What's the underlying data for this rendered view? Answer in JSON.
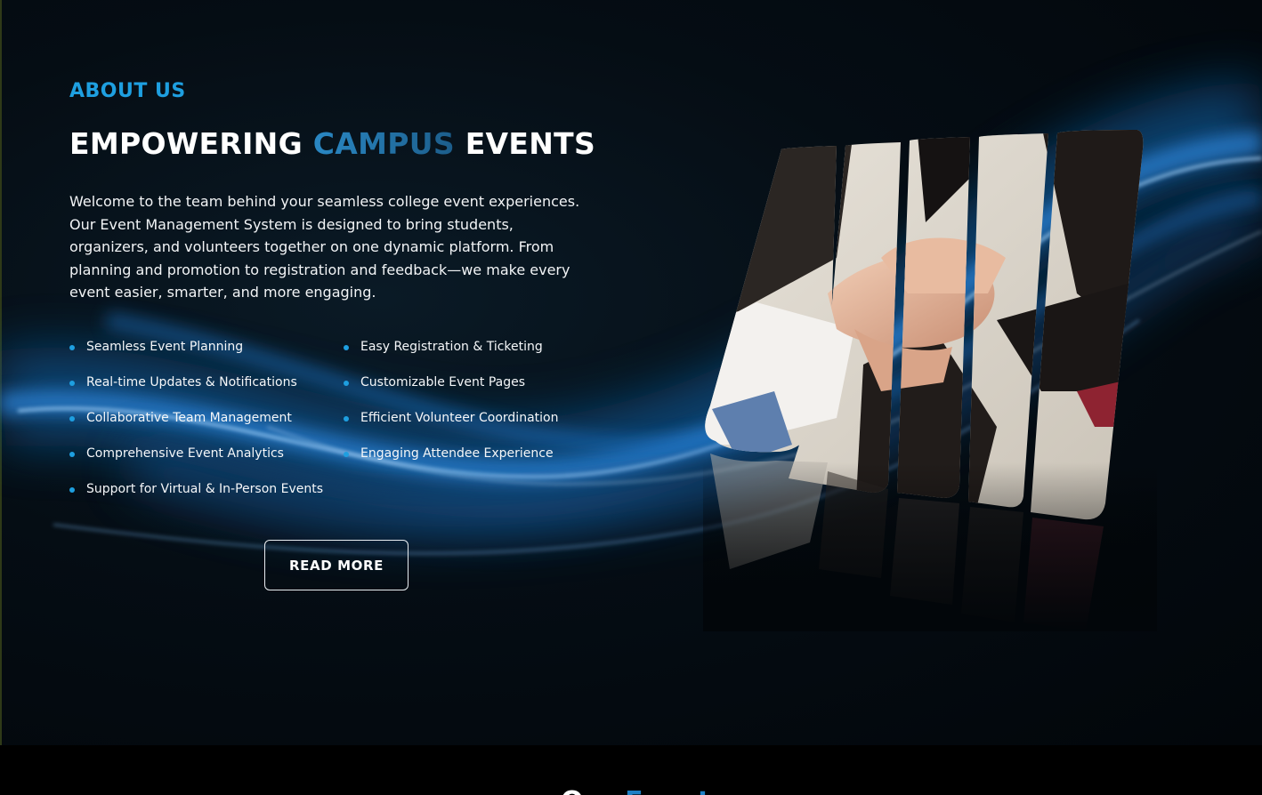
{
  "about": {
    "eyebrow": "ABOUT US",
    "headline": {
      "part1": "EMPOWERING ",
      "accent": "CAMPUS",
      "part2": " EVENTS"
    },
    "intro": "Welcome to the team behind your seamless college event experiences. Our Event Management System is designed to bring students, organizers, and volunteers together on one dynamic platform. From planning and promotion to registration and feedback—we make every event easier, smarter, and more engaging.",
    "features": [
      "Seamless Event Planning",
      "Easy Registration & Ticketing",
      "Real-time Updates & Notifications",
      "Customizable Event Pages",
      "Collaborative Team Management",
      "Efficient Volunteer Coordination",
      "Comprehensive Event Analytics",
      "Engaging Attendee Experience",
      "Support for Virtual & In-Person Events"
    ],
    "read_more_label": "READ MORE",
    "image_icon": "team-hands-photo-icon"
  },
  "next_section": {
    "title_part1": "Our ",
    "title_accent": "Events"
  },
  "colors": {
    "accent": "#1e9fe0",
    "background": "#050d14",
    "text": "#ffffff"
  }
}
